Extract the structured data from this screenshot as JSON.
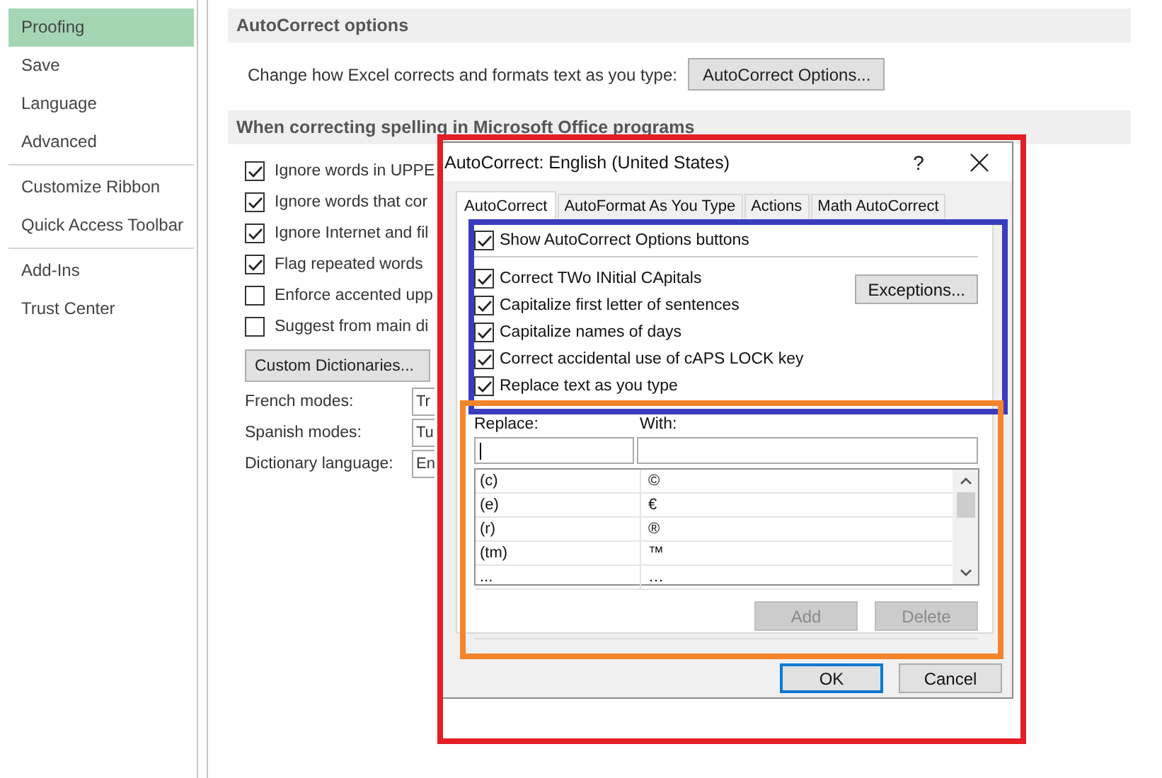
{
  "sidebar": {
    "groups": [
      {
        "items": [
          {
            "label": "Proofing",
            "selected": true
          },
          {
            "label": "Save",
            "selected": false
          },
          {
            "label": "Language",
            "selected": false
          },
          {
            "label": "Advanced",
            "selected": false
          }
        ]
      },
      {
        "items": [
          {
            "label": "Customize Ribbon",
            "selected": false
          },
          {
            "label": "Quick Access Toolbar",
            "selected": false
          }
        ]
      },
      {
        "items": [
          {
            "label": "Add-Ins",
            "selected": false
          },
          {
            "label": "Trust Center",
            "selected": false
          }
        ]
      }
    ]
  },
  "autocorrect_section": {
    "title": "AutoCorrect options",
    "description": "Change how Excel corrects and formats text as you type:",
    "button": "AutoCorrect Options..."
  },
  "spelling_section": {
    "title": "When correcting spelling in Microsoft Office programs",
    "options": [
      {
        "label": "Ignore words in UPPE",
        "checked": true
      },
      {
        "label": "Ignore words that cor",
        "checked": true
      },
      {
        "label": "Ignore Internet and fil",
        "checked": true
      },
      {
        "label": "Flag repeated words",
        "checked": true
      },
      {
        "label": "Enforce accented upp",
        "checked": false
      },
      {
        "label": "Suggest from main di",
        "checked": false
      }
    ],
    "button": "Custom Dictionaries...",
    "fields": [
      {
        "label": "French modes:",
        "value": "Tr"
      },
      {
        "label": "Spanish modes:",
        "value": "Tu"
      },
      {
        "label": "Dictionary language:",
        "value": "En"
      }
    ]
  },
  "dialog": {
    "title": "AutoCorrect: English (United States)",
    "help": "?",
    "tabs": [
      {
        "label": "AutoCorrect",
        "selected": true
      },
      {
        "label": "AutoFormat As You Type",
        "selected": false
      },
      {
        "label": "Actions",
        "selected": false
      },
      {
        "label": "Math AutoCorrect",
        "selected": false
      }
    ],
    "show_buttons": {
      "label": "Show AutoCorrect Options buttons",
      "checked": true
    },
    "options": [
      {
        "label": "Correct TWo INitial CApitals",
        "checked": true
      },
      {
        "label": "Capitalize first letter of sentences",
        "checked": true
      },
      {
        "label": "Capitalize names of days",
        "checked": true
      },
      {
        "label": "Correct accidental use of cAPS LOCK key",
        "checked": true
      }
    ],
    "exceptions_button": "Exceptions...",
    "replace_text": {
      "label": "Replace text as you type",
      "checked": true
    },
    "replace_label": "Replace:",
    "with_label": "With:",
    "entries": [
      {
        "replace": "(c)",
        "with": "©"
      },
      {
        "replace": "(e)",
        "with": "€"
      },
      {
        "replace": "(r)",
        "with": "®"
      },
      {
        "replace": "(tm)",
        "with": "™"
      },
      {
        "replace": "...",
        "with": "…"
      }
    ],
    "list_buttons": [
      {
        "label": "Add",
        "disabled": true
      },
      {
        "label": "Delete",
        "disabled": true
      }
    ],
    "buttons": [
      {
        "label": "OK",
        "focused": true
      },
      {
        "label": "Cancel",
        "focused": false
      }
    ]
  },
  "annotations": [
    {
      "color": "#e31e25"
    },
    {
      "color": "#3b3bbf"
    },
    {
      "color": "#f5842a"
    }
  ]
}
